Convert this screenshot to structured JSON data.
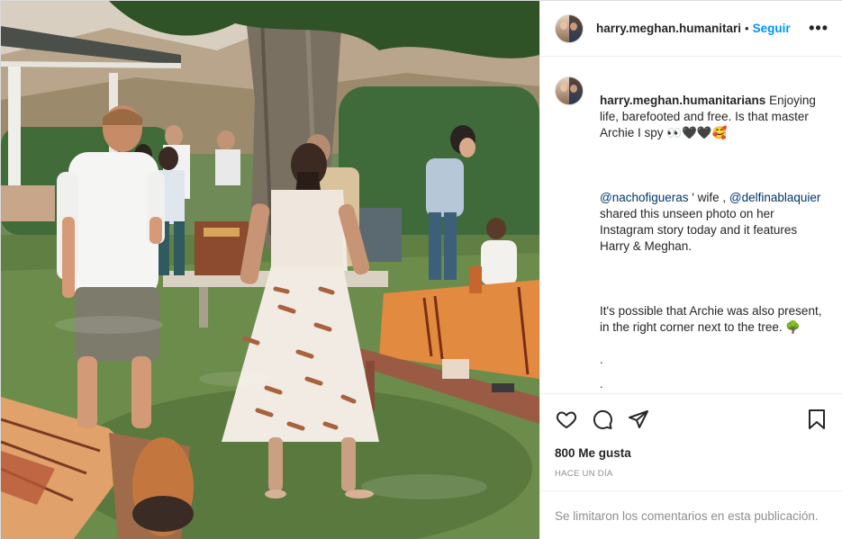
{
  "post": {
    "username": "harry.meghan.humanitari",
    "header_separator": "•",
    "follow_label": "Seguir",
    "more_label": "•••",
    "caption": {
      "username": "harry.meghan.humanitarians",
      "line1": " Enjoying life, barefooted and free. Is that master Archie I spy 👀🖤🖤🥰",
      "mention1": "@nachofigueras",
      "mid1": " ' wife , ",
      "mention2": "@delfinablaquier",
      "line2": " shared this unseen photo on her Instagram story today and it features Harry & Meghan.",
      "line3": "It's possible that Archie was also present, in the right corner next to the tree. 🌳",
      "dots": [
        ".",
        ".",
        ".",
        ".",
        "."
      ]
    },
    "likes_label": "800 Me gusta",
    "time_label": "HACE UN DÍA",
    "comments_disabled_label": "Se limitaron los comentarios en esta publicación."
  },
  "icons": {
    "like": "heart-icon",
    "comment": "comment-icon",
    "share": "share-icon",
    "save": "bookmark-icon",
    "more": "more-icon"
  },
  "colors": {
    "link_blue": "#0095f6",
    "mention_blue": "#00376b",
    "muted_gray": "#8e8e8e",
    "border": "#efefef"
  }
}
